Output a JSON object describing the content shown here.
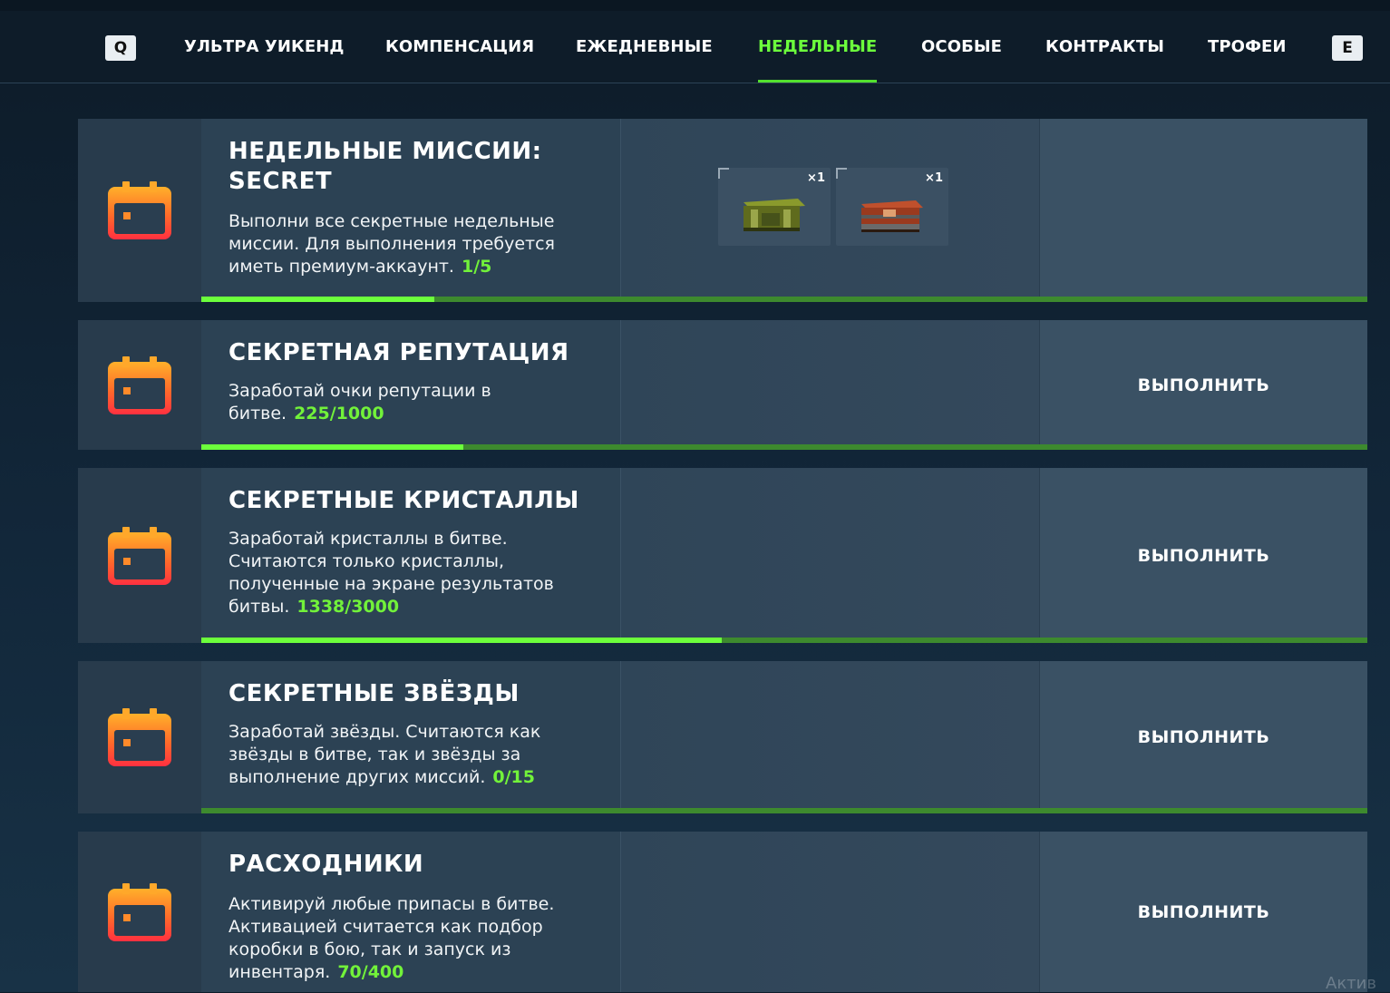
{
  "nav": {
    "key_left": "Q",
    "key_right": "E",
    "tabs": [
      {
        "label": "УЛЬТРА УИКЕНД",
        "active": false
      },
      {
        "label": "КОМПЕНСАЦИЯ",
        "active": false
      },
      {
        "label": "ЕЖЕДНЕВНЫЕ",
        "active": false
      },
      {
        "label": "НЕДЕЛЬНЫЕ",
        "active": true
      },
      {
        "label": "ОСОБЫЕ",
        "active": false
      },
      {
        "label": "КОНТРАКТЫ",
        "active": false
      },
      {
        "label": "ТРОФЕИ",
        "active": false
      }
    ]
  },
  "colors": {
    "accent": "#6cff3c",
    "progress_track": "#3d8a2e"
  },
  "missions": [
    {
      "icon": "calendar-icon",
      "title": "НЕДЕЛЬНЫЕ МИССИИ: SECRET",
      "description": "Выполни все секретные недельные миссии. Для выполнения требуется иметь премиум-аккаунт.",
      "progress_text": "1/5",
      "progress": 0.2,
      "rewards": [
        {
          "icon": "green-container-icon",
          "count": "×1"
        },
        {
          "icon": "red-container-icon",
          "count": "×1"
        }
      ],
      "action": ""
    },
    {
      "icon": "calendar-icon",
      "title": "СЕКРЕТНАЯ РЕПУТАЦИЯ",
      "description": "Заработай очки репутации в битве.",
      "progress_text": "225/1000",
      "progress": 0.225,
      "action": "ВЫПОЛНИТЬ"
    },
    {
      "icon": "calendar-icon",
      "title": "СЕКРЕТНЫЕ КРИСТАЛЛЫ",
      "description": "Заработай кристаллы в битве. Считаются только кристаллы, полученные на экране результатов битвы.",
      "progress_text": "1338/3000",
      "progress": 0.446,
      "action": "ВЫПОЛНИТЬ"
    },
    {
      "icon": "calendar-icon",
      "title": "СЕКРЕТНЫЕ ЗВЁЗДЫ",
      "description": "Заработай звёзды. Считаются как звёзды в битве, так и звёзды за выполнение других миссий.",
      "progress_text": "0/15",
      "progress": 0,
      "action": "ВЫПОЛНИТЬ"
    },
    {
      "icon": "calendar-icon",
      "title": "РАСХОДНИКИ",
      "description": "Активируй любые припасы в битве. Активацией считается как подбор коробки в бою, так и запуск из инвентаря.",
      "progress_text": "70/400",
      "progress": 0.175,
      "action": "ВЫПОЛНИТЬ"
    }
  ],
  "watermark": "Актив"
}
